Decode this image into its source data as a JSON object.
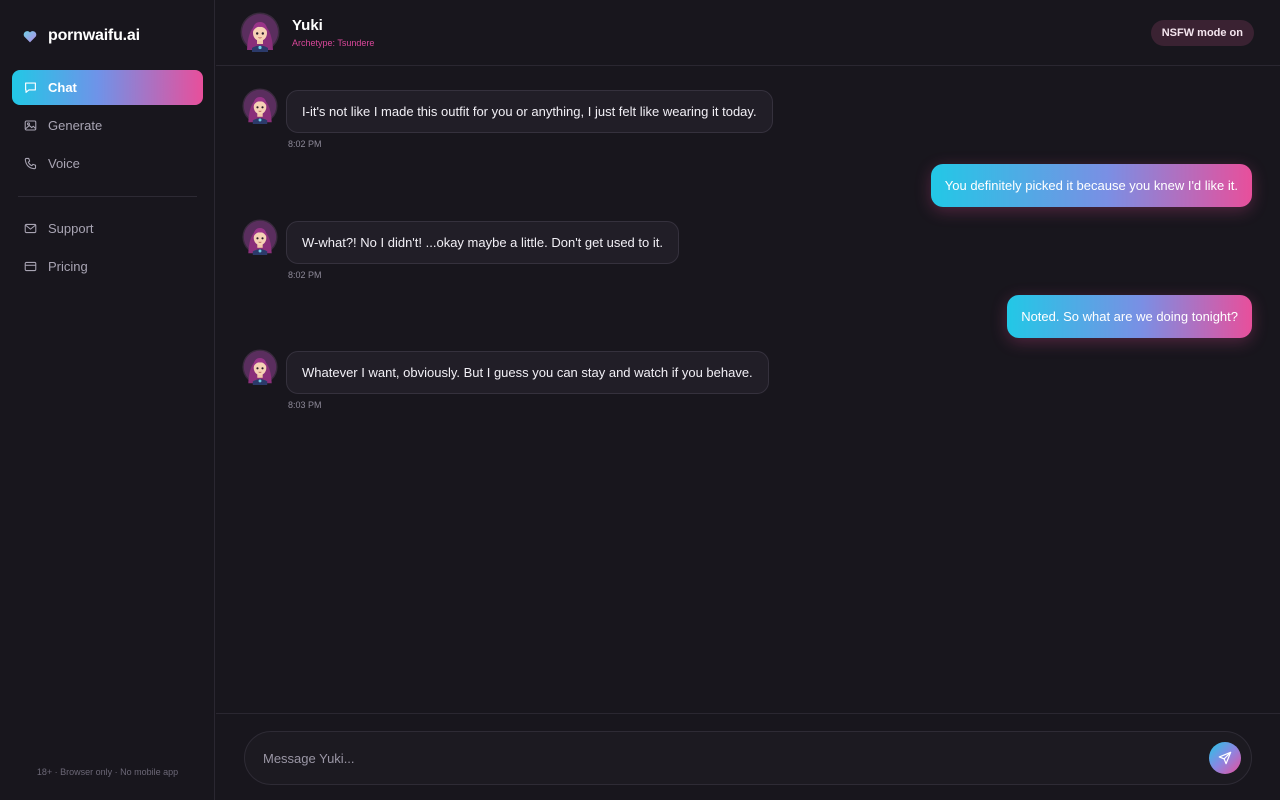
{
  "app": {
    "brand": "pornwaifu.ai",
    "footer": "18+ · Browser only · No mobile app"
  },
  "sidebar": {
    "items": [
      {
        "label": "Chat",
        "icon": "chat-icon",
        "active": true
      },
      {
        "label": "Generate",
        "icon": "image-icon",
        "active": false
      },
      {
        "label": "Voice",
        "icon": "phone-icon",
        "active": false
      },
      {
        "label": "Support",
        "icon": "mail-icon",
        "active": false
      },
      {
        "label": "Pricing",
        "icon": "credit-card-icon",
        "active": false
      }
    ]
  },
  "header": {
    "name": "Yuki",
    "archetype": "Archetype: Tsundere",
    "badge": "NSFW mode on"
  },
  "messages": [
    {
      "from": "bot",
      "text": "I-it's not like I made this outfit for you or anything, I just felt like wearing it today.",
      "time": "8:02 PM"
    },
    {
      "from": "user",
      "text": "You definitely picked it because you knew I'd like it."
    },
    {
      "from": "bot",
      "text": "W-what?! No I didn't! ...okay maybe a little. Don't get used to it.",
      "time": "8:02 PM"
    },
    {
      "from": "user",
      "text": "Noted. So what are we doing tonight?"
    },
    {
      "from": "bot",
      "text": "Whatever I want, obviously. But I guess you can stay and watch if you behave.",
      "time": "8:03 PM"
    }
  ],
  "composer": {
    "placeholder": "Message Yuki...",
    "send_icon": "send-icon"
  },
  "colors": {
    "accent_cyan": "#22c8e6",
    "accent_pink": "#e84f9b",
    "background": "#18161d",
    "bubble_bot": "#211e27"
  }
}
